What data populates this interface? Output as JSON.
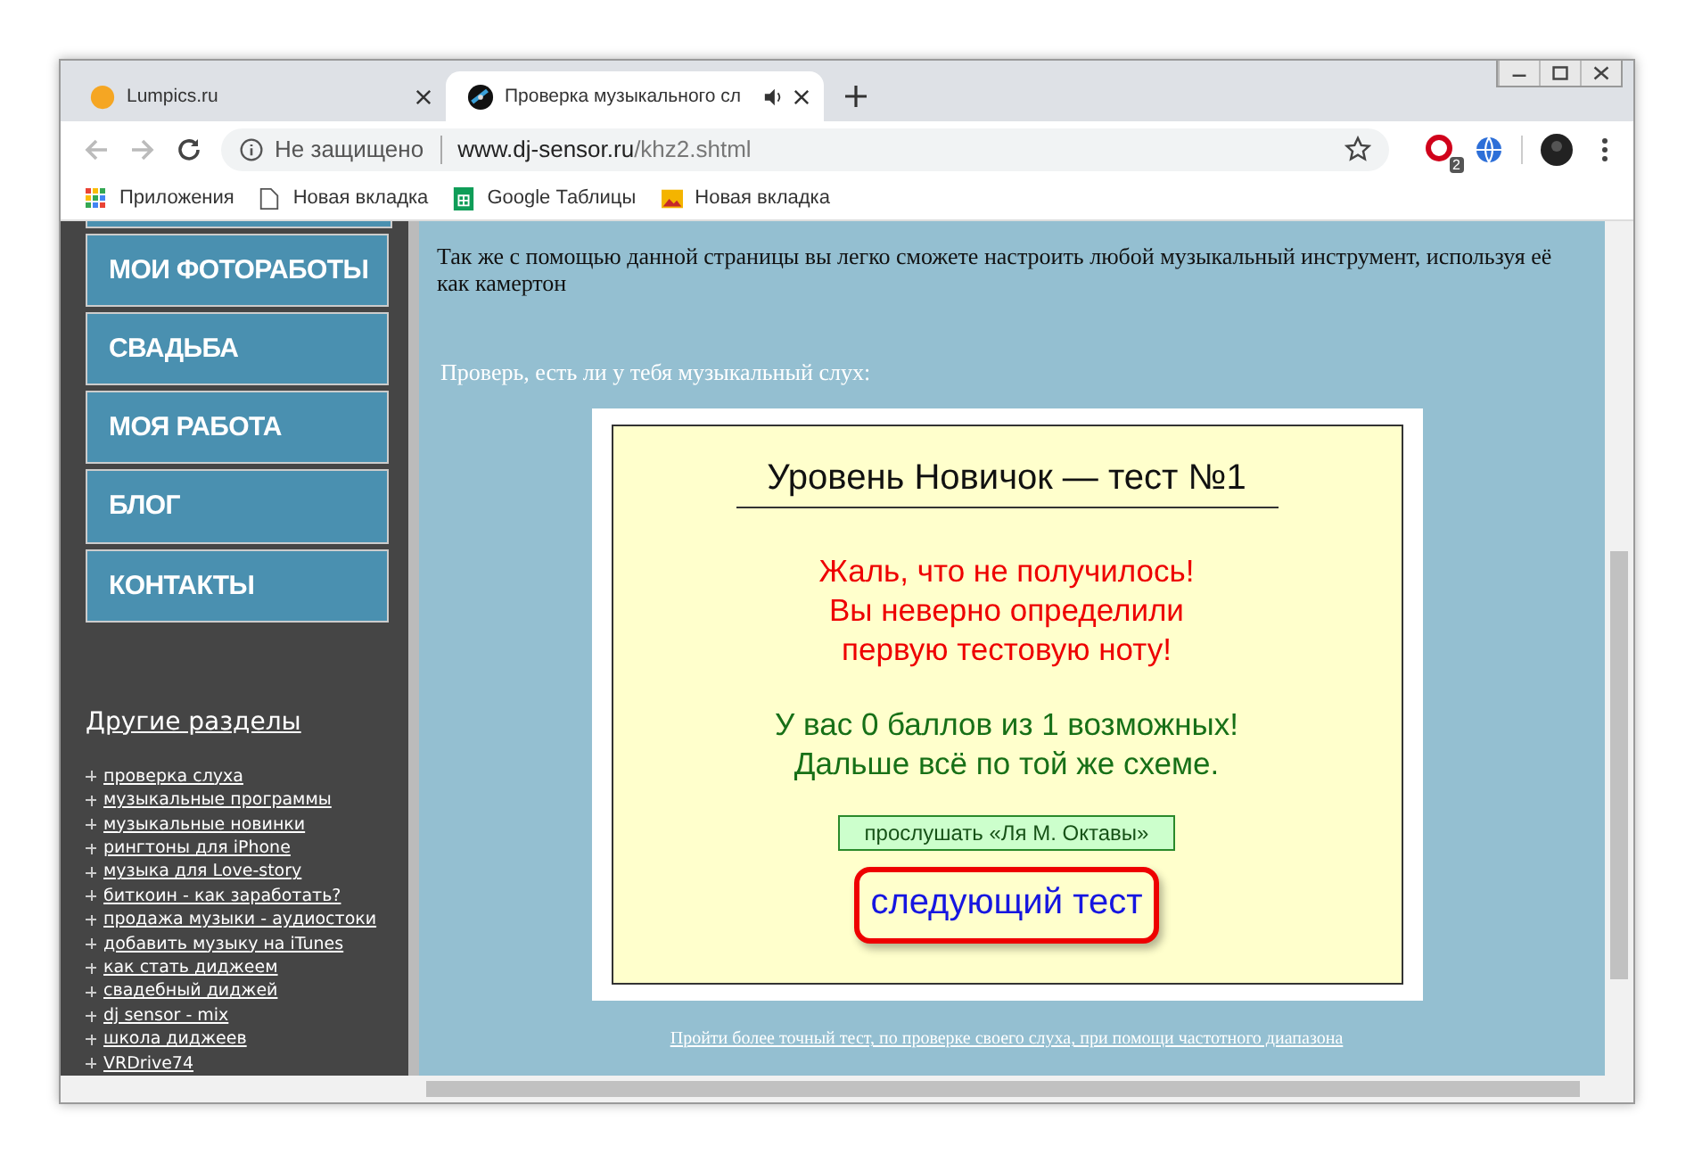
{
  "tabs": [
    {
      "title": "Lumpics.ru",
      "selected": false,
      "audio": false
    },
    {
      "title": "Проверка музыкального сл",
      "selected": true,
      "audio": true
    }
  ],
  "address_bar": {
    "security": "Не защищено",
    "host": "www.dj-sensor.ru",
    "path": "/khz2.shtml"
  },
  "extensions": {
    "badge": "2"
  },
  "bookmarks": [
    {
      "title": "Приложения",
      "kind": "apps"
    },
    {
      "title": "Новая вкладка",
      "kind": "page"
    },
    {
      "title": "Google Таблицы",
      "kind": "sheets"
    },
    {
      "title": "Новая вкладка",
      "kind": "image"
    }
  ],
  "sidebar": {
    "menu": [
      "МОИ ФОТОРАБОТЫ",
      "СВАДЬБА",
      "МОЯ РАБОТА",
      "БЛОГ",
      "КОНТАКТЫ"
    ],
    "sections_title": "Другие разделы",
    "links": [
      "проверка слуха",
      "музыкальные программы",
      "музыкальные новинки",
      "рингтоны для iPhone",
      "музыка для Love-story",
      "биткоин - как заработать?",
      "продажа музыки - аудиостоки",
      "добавить музыку на iTunes",
      "как стать диджеем",
      "свадебный диджей",
      "dj sensor - mix",
      "школа диджеев",
      "VRDrive74"
    ]
  },
  "content": {
    "intro": "Так же с помощью данной страницы вы легко сможете настроить любой музыкальный инструмент, используя её как камертон",
    "prompt": "Проверь, есть ли у тебя музыкальный слух:",
    "test": {
      "title": "Уровень Новичок — тест №1",
      "result_lines": [
        "Жаль, что не получилось!",
        "Вы неверно определили",
        "первую тестовую ноту!"
      ],
      "score_lines": [
        "У вас 0 баллов из 1 возможных!",
        "Дальше всё по той же схеме."
      ],
      "listen_button": "прослушать «Ля М. Октавы»",
      "next_button": "следующий тест"
    },
    "footer_link": "Пройти более точный тест, по проверке своего слуха, при помощи частотного диапазона"
  }
}
